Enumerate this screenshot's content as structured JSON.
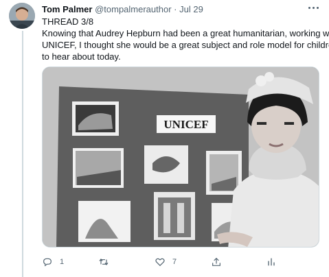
{
  "tweet": {
    "author_name": "Tom Palmer",
    "handle": "@tompalmerauthor",
    "separator": "·",
    "date": "Jul 29",
    "text_lines": [
      "THREAD 3/8",
      "Knowing that Audrey Hepburn had been a great humanitarian, working with",
      "UNICEF, I thought she would be a great subject and role model for children",
      "to hear about today."
    ],
    "media": {
      "sign_text": "UNICEF"
    }
  },
  "actions": {
    "reply": {
      "icon": "reply-icon",
      "count": "1"
    },
    "retweet": {
      "icon": "retweet-icon",
      "count": ""
    },
    "like": {
      "icon": "heart-icon",
      "count": "7"
    },
    "share": {
      "icon": "share-icon"
    },
    "analytics": {
      "icon": "analytics-icon"
    }
  },
  "colors": {
    "text": "#0f1419",
    "secondary": "#536471",
    "divider": "#cfd9de"
  }
}
